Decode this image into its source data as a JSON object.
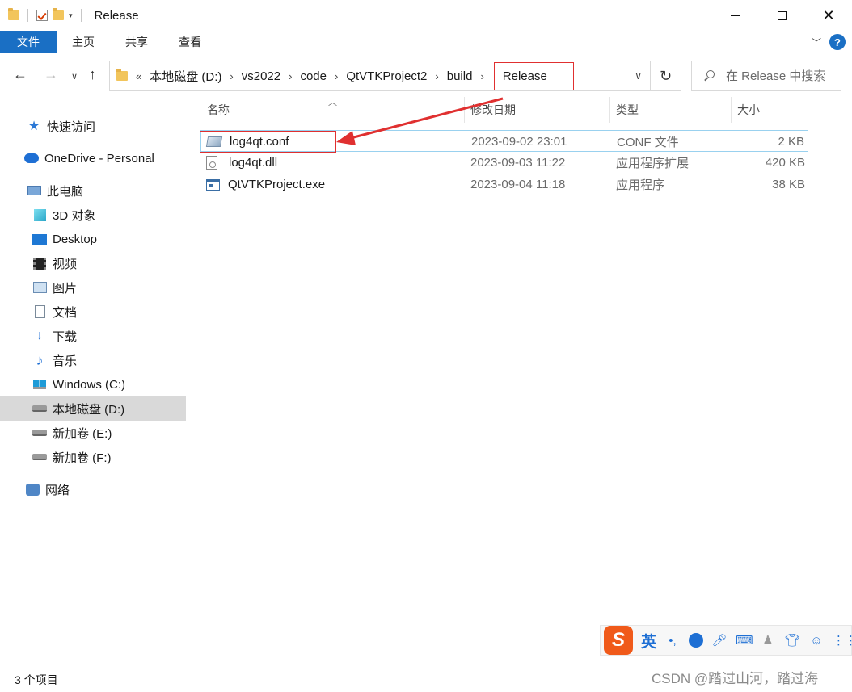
{
  "window": {
    "title": "Release"
  },
  "ribbon": {
    "tabs": [
      "文件",
      "主页",
      "共享",
      "查看"
    ],
    "help": "?"
  },
  "address": {
    "prefix": "«",
    "crumbs": [
      "本地磁盘 (D:)",
      "vs2022",
      "code",
      "QtVTKProject2",
      "build",
      "Release"
    ],
    "search_placeholder": "在 Release 中搜索"
  },
  "sidebar": {
    "items": [
      {
        "label": "快速访问",
        "icon": "star-icon"
      },
      {
        "label": "OneDrive - Personal",
        "icon": "onedrive-icon"
      },
      {
        "label": "此电脑",
        "icon": "pc-icon"
      },
      {
        "label": "3D 对象",
        "icon": "3d-objects-icon"
      },
      {
        "label": "Desktop",
        "icon": "desktop-icon"
      },
      {
        "label": "视频",
        "icon": "video-icon"
      },
      {
        "label": "图片",
        "icon": "pictures-icon"
      },
      {
        "label": "文档",
        "icon": "documents-icon"
      },
      {
        "label": "下载",
        "icon": "download-icon"
      },
      {
        "label": "音乐",
        "icon": "music-icon"
      },
      {
        "label": "Windows (C:)",
        "icon": "windows-drive-icon"
      },
      {
        "label": "本地磁盘 (D:)",
        "icon": "drive-icon",
        "selected": true
      },
      {
        "label": "新加卷 (E:)",
        "icon": "drive-icon"
      },
      {
        "label": "新加卷 (F:)",
        "icon": "drive-icon"
      },
      {
        "label": "网络",
        "icon": "network-icon"
      }
    ]
  },
  "filelist": {
    "columns": [
      "名称",
      "修改日期",
      "类型",
      "大小"
    ],
    "files": [
      {
        "name": "log4qt.conf",
        "date": "2023-09-02 23:01",
        "type": "CONF 文件",
        "size": "2 KB",
        "icon": "conf-file-icon"
      },
      {
        "name": "log4qt.dll",
        "date": "2023-09-03 11:22",
        "type": "应用程序扩展",
        "size": "420 KB",
        "icon": "dll-file-icon"
      },
      {
        "name": "QtVTKProject.exe",
        "date": "2023-09-04 11:18",
        "type": "应用程序",
        "size": "38 KB",
        "icon": "exe-file-icon"
      }
    ]
  },
  "status": {
    "count": "3 个项目"
  },
  "ime": {
    "logo": "S",
    "lang": "英",
    "punct": "•,"
  },
  "watermark": "CSDN @踏过山河，踏过海",
  "colors": {
    "accent": "#1a6fc4",
    "annotation": "#e03030",
    "selection_border": "#99d1ef"
  }
}
